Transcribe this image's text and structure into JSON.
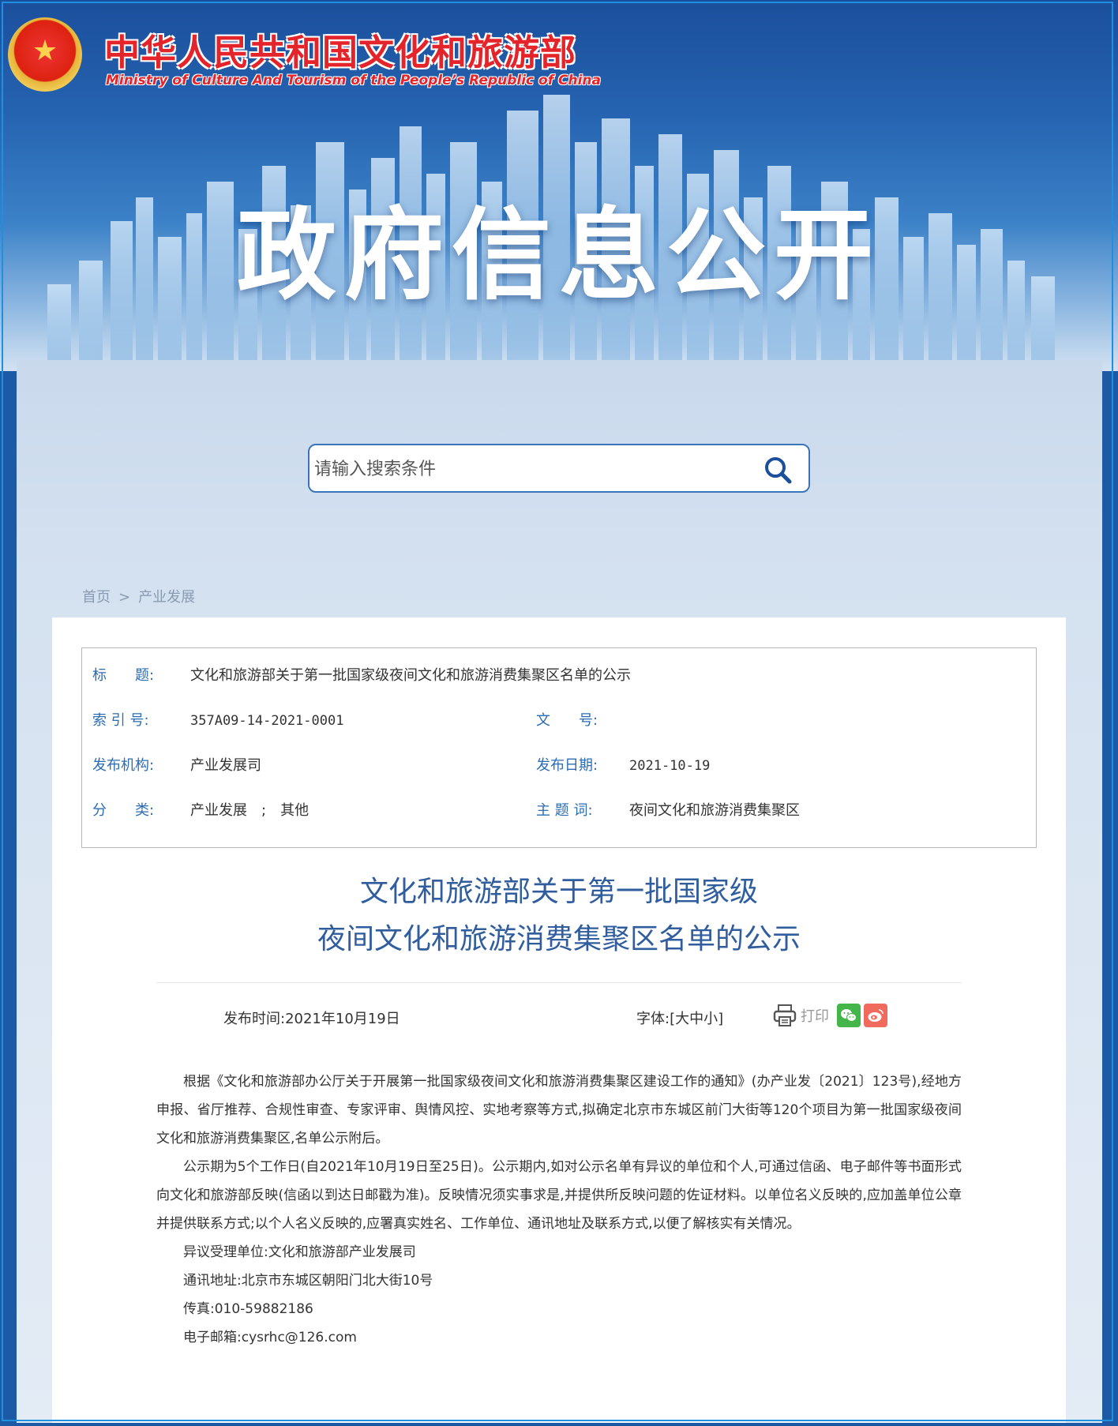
{
  "site": {
    "name_cn": "中华人民共和国文化和旅游部",
    "name_en": "Ministry of Culture And Tourism of the People’s Republic of China",
    "banner_title": "政府信息公开"
  },
  "search": {
    "placeholder": "请输入搜索条件"
  },
  "breadcrumb": {
    "home": "首页",
    "separator": ">",
    "current": "产业发展"
  },
  "meta": {
    "title_label": "标　　题:",
    "title_value": "文化和旅游部关于第一批国家级夜间文化和旅游消费集聚区名单的公示",
    "index_label": "索 引 号:",
    "index_value": "357A09-14-2021-0001",
    "docno_label": "文　　号:",
    "docno_value": "",
    "org_label": "发布机构:",
    "org_value": "产业发展司",
    "date_label": "发布日期:",
    "date_value": "2021-10-19",
    "category_label": "分　　类:",
    "category_value": "产业发展　;　其他",
    "topic_label": "主 题 词:",
    "topic_value": "夜间文化和旅游消费集聚区"
  },
  "article": {
    "title_line1": "文化和旅游部关于第一批国家级",
    "title_line2": "夜间文化和旅游消费集聚区名单的公示",
    "pub_time": "发布时间:2021年10月19日",
    "font_size_ctrl": "字体:[大中小]",
    "print_label": "打印",
    "paragraphs": [
      "根据《文化和旅游部办公厅关于开展第一批国家级夜间文化和旅游消费集聚区建设工作的通知》(办产业发〔2021〕123号),经地方申报、省厅推荐、合规性审查、专家评审、舆情风控、实地考察等方式,拟确定北京市东城区前门大街等120个项目为第一批国家级夜间文化和旅游消费集聚区,名单公示附后。",
      "公示期为5个工作日(自2021年10月19日至25日)。公示期内,如对公示名单有异议的单位和个人,可通过信函、电子邮件等书面形式向文化和旅游部反映(信函以到达日邮戳为准)。反映情况须实事求是,并提供所反映问题的佐证材料。以单位名义反映的,应加盖单位公章并提供联系方式;以个人名义反映的,应署真实姓名、工作单位、通讯地址及联系方式,以便了解核实有关情况。",
      "异议受理单位:文化和旅游部产业发展司",
      "通讯地址:北京市东城区朝阳门北大街10号",
      "传真:010-59882186",
      "电子邮箱:cysrhc@126.com"
    ]
  },
  "colors": {
    "header_blue": "#1b4f9c",
    "label_blue": "#2c6cb3",
    "title_blue": "#2f5d9d",
    "brand_red": "#e4242b",
    "wechat_green": "#44b549",
    "weibo_red": "#f06a5e"
  },
  "icons": [
    "national-emblem-icon",
    "search-icon",
    "print-icon",
    "wechat-icon",
    "weibo-icon"
  ]
}
